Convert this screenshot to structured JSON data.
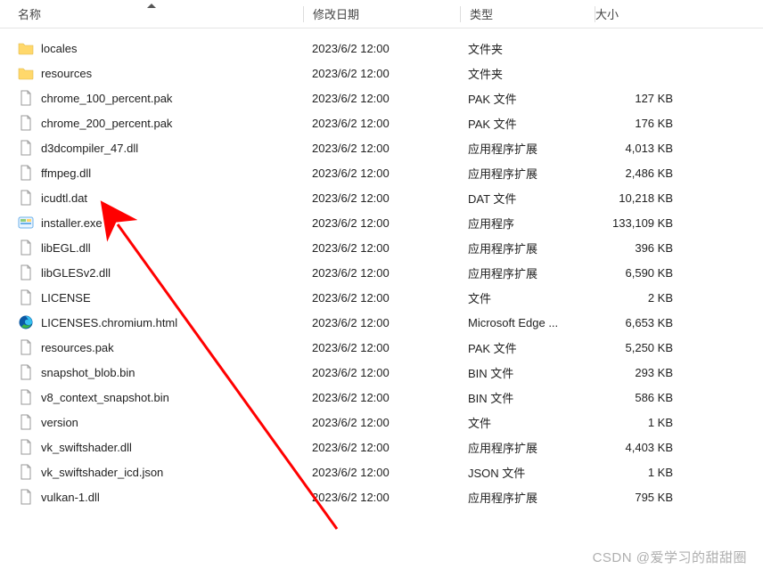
{
  "columns": {
    "name": "名称",
    "date": "修改日期",
    "type": "类型",
    "size": "大小"
  },
  "files": [
    {
      "name": "locales",
      "date": "2023/6/2 12:00",
      "type": "文件夹",
      "size": "",
      "icon": "folder"
    },
    {
      "name": "resources",
      "date": "2023/6/2 12:00",
      "type": "文件夹",
      "size": "",
      "icon": "folder"
    },
    {
      "name": "chrome_100_percent.pak",
      "date": "2023/6/2 12:00",
      "type": "PAK 文件",
      "size": "127 KB",
      "icon": "file"
    },
    {
      "name": "chrome_200_percent.pak",
      "date": "2023/6/2 12:00",
      "type": "PAK 文件",
      "size": "176 KB",
      "icon": "file"
    },
    {
      "name": "d3dcompiler_47.dll",
      "date": "2023/6/2 12:00",
      "type": "应用程序扩展",
      "size": "4,013 KB",
      "icon": "file"
    },
    {
      "name": "ffmpeg.dll",
      "date": "2023/6/2 12:00",
      "type": "应用程序扩展",
      "size": "2,486 KB",
      "icon": "file"
    },
    {
      "name": "icudtl.dat",
      "date": "2023/6/2 12:00",
      "type": "DAT 文件",
      "size": "10,218 KB",
      "icon": "file"
    },
    {
      "name": "installer.exe",
      "date": "2023/6/2 12:00",
      "type": "应用程序",
      "size": "133,109 KB",
      "icon": "exe"
    },
    {
      "name": "libEGL.dll",
      "date": "2023/6/2 12:00",
      "type": "应用程序扩展",
      "size": "396 KB",
      "icon": "file"
    },
    {
      "name": "libGLESv2.dll",
      "date": "2023/6/2 12:00",
      "type": "应用程序扩展",
      "size": "6,590 KB",
      "icon": "file"
    },
    {
      "name": "LICENSE",
      "date": "2023/6/2 12:00",
      "type": "文件",
      "size": "2 KB",
      "icon": "file"
    },
    {
      "name": "LICENSES.chromium.html",
      "date": "2023/6/2 12:00",
      "type": "Microsoft Edge ...",
      "size": "6,653 KB",
      "icon": "edge"
    },
    {
      "name": "resources.pak",
      "date": "2023/6/2 12:00",
      "type": "PAK 文件",
      "size": "5,250 KB",
      "icon": "file"
    },
    {
      "name": "snapshot_blob.bin",
      "date": "2023/6/2 12:00",
      "type": "BIN 文件",
      "size": "293 KB",
      "icon": "file"
    },
    {
      "name": "v8_context_snapshot.bin",
      "date": "2023/6/2 12:00",
      "type": "BIN 文件",
      "size": "586 KB",
      "icon": "file"
    },
    {
      "name": "version",
      "date": "2023/6/2 12:00",
      "type": "文件",
      "size": "1 KB",
      "icon": "file"
    },
    {
      "name": "vk_swiftshader.dll",
      "date": "2023/6/2 12:00",
      "type": "应用程序扩展",
      "size": "4,403 KB",
      "icon": "file"
    },
    {
      "name": "vk_swiftshader_icd.json",
      "date": "2023/6/2 12:00",
      "type": "JSON 文件",
      "size": "1 KB",
      "icon": "file"
    },
    {
      "name": "vulkan-1.dll",
      "date": "2023/6/2 12:00",
      "type": "应用程序扩展",
      "size": "795 KB",
      "icon": "file"
    }
  ],
  "watermark": "CSDN @爱学习的甜甜圈"
}
